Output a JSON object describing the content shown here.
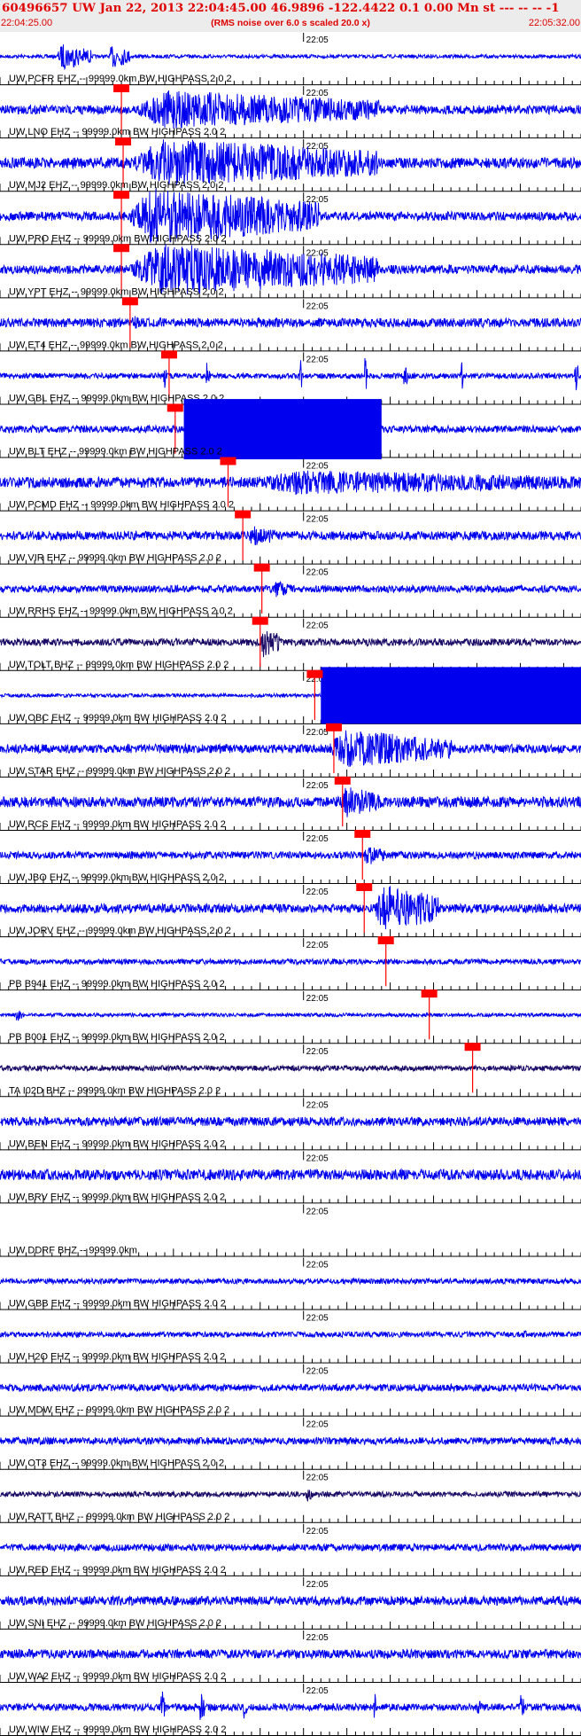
{
  "header": {
    "title": "60496657 UW Jan 22, 2013 22:04:45.00   46.9896 -122.4422  0.1 0.00 Mn st --- -- --  -1",
    "start_time": "22:04:25.00",
    "end_time": "22:05:32.00",
    "scale_note": "(RMS noise over 6.0 s scaled 20.0 x)"
  },
  "colors": {
    "trace": "#0000ee",
    "trace_dark": "#1a0a66",
    "pick": "#ff0000",
    "axis": "#000000",
    "header_bg": "#ececec",
    "title": "#e00000"
  },
  "chart_data": {
    "type": "line",
    "x_unit": "time (UTC)",
    "xlim": [
      "22:04:25.00",
      "22:05:32.00"
    ],
    "minute_tick_label": "22:05",
    "minute_tick_time": "22:05:00",
    "traces": [
      {
        "label": "UW PCFR EHZ -- 99999.0km BW  HIGHPASS  2.0  2",
        "pick_time": null,
        "noise": 2,
        "bursts": [
          [
            "22:04:31.5",
            "22:04:35.5",
            15
          ],
          [
            "22:04:37.5",
            "22:04:40.0",
            14
          ]
        ]
      },
      {
        "label": "UW LNO EHZ -- 99999.0km BW  HIGHPASS  2.0  2",
        "pick_time": "22:04:39.0",
        "noise": 5,
        "bursts": [
          [
            "22:04:39.5",
            "22:05:09.0",
            22
          ]
        ]
      },
      {
        "label": "UW MJ2 EHZ -- 99999.0km BW  HIGHPASS  2.0  2",
        "pick_time": "22:04:39.2",
        "noise": 6,
        "bursts": [
          [
            "22:04:39.4",
            "22:05:08.7",
            28
          ]
        ]
      },
      {
        "label": "UW PRO EHZ -- 99999.0km BW  HIGHPASS  2.0  2",
        "pick_time": "22:04:39.0",
        "noise": 5,
        "bursts": [
          [
            "22:04:39.2",
            "22:05:01.7",
            32
          ]
        ]
      },
      {
        "label": "UW YPT EHZ -- 99999.0km BW  HIGHPASS  2.0  2",
        "pick_time": "22:04:39.0",
        "noise": 5,
        "bursts": [
          [
            "22:04:39.2",
            "22:05:08.7",
            30
          ]
        ]
      },
      {
        "label": "UW ET4 EHZ -- 99999.0km BW  HIGHPASS  2.0  2",
        "pick_time": "22:04:40.0",
        "noise": 5,
        "bursts": [
          [
            "22:04:40.0",
            "22:04:42.0",
            8
          ]
        ]
      },
      {
        "label": "UW GBL EHZ -- 99999.0km BW  HIGHPASS  2.0  2",
        "pick_time": "22:04:44.5",
        "noise": 3,
        "bursts": [
          [
            "22:04:43.8",
            "22:04:44.2",
            20
          ],
          [
            "22:04:48.7",
            "22:04:49.2",
            18
          ],
          [
            "22:04:59.5",
            "22:04:59.8",
            22
          ],
          [
            "22:05:07.0",
            "22:05:07.3",
            24
          ],
          [
            "22:05:11.5",
            "22:05:12.0",
            22
          ],
          [
            "22:05:18.0",
            "22:05:18.4",
            24
          ],
          [
            "22:05:31.2",
            "22:05:31.6",
            22
          ]
        ]
      },
      {
        "label": "UW BLT EHZ -- 99999.0km BW  HIGHPASS  2.0  2",
        "pick_time": "22:04:45.2",
        "noise": 4,
        "blocks": [
          [
            "22:04:46.2",
            "22:05:09.0",
            34
          ]
        ]
      },
      {
        "label": "UW PCMD EHZ -- 99999.0km BW  HIGHPASS  2.0  2",
        "pick_time": "22:04:51.3",
        "noise": 6,
        "bursts": [
          [
            "22:04:53.0",
            "22:05:32.0",
            14
          ]
        ]
      },
      {
        "label": "UW VIR EHZ -- 99999.0km BW  HIGHPASS  2.0  2",
        "pick_time": "22:04:53.0",
        "noise": 5,
        "bursts": [
          [
            "22:04:53.5",
            "22:04:57.0",
            12
          ]
        ]
      },
      {
        "label": "UW RRHS EHZ -- 99999.0km BW  HIGHPASS  2.0  2",
        "pick_time": "22:04:55.2",
        "noise": 4,
        "bursts": [
          [
            "22:04:56.5",
            "22:04:58.5",
            10
          ]
        ]
      },
      {
        "label": "UW TOLT BHZ -- 99999.0km BW  HIGHPASS  2.0  2",
        "pick_time": "22:04:55.0",
        "noise": 4,
        "dark": true,
        "bursts": [
          [
            "22:04:55.0",
            "22:04:57.2",
            18
          ]
        ]
      },
      {
        "label": "UW OBC EHZ -- 99999.0km BW  HIGHPASS  2.0  2",
        "pick_time": "22:05:01.3",
        "noise": 2,
        "blocks": [
          [
            "22:05:02.0",
            "22:05:32.0",
            32
          ]
        ]
      },
      {
        "label": "UW STAR EHZ -- 99999.0km BW  HIGHPASS  2.0  2",
        "pick_time": "22:05:03.5",
        "noise": 5,
        "bursts": [
          [
            "22:05:02.5",
            "22:05:17.0",
            22
          ]
        ]
      },
      {
        "label": "UW RCS EHZ -- 99999.0km BW  HIGHPASS  2.0  2",
        "pick_time": "22:05:04.5",
        "noise": 6,
        "bursts": [
          [
            "22:05:04.0",
            "22:05:09.0",
            18
          ]
        ]
      },
      {
        "label": "UW JBO EHZ -- 99999.0km BW  HIGHPASS  2.0  2",
        "pick_time": "22:05:06.8",
        "noise": 4,
        "bursts": [
          [
            "22:05:06.8",
            "22:05:09.5",
            12
          ]
        ]
      },
      {
        "label": "UW JORV EHZ -- 99999.0km BW  HIGHPASS  2.0  2",
        "pick_time": "22:05:07.0",
        "noise": 5,
        "bursts": [
          [
            "22:05:08.0",
            "22:05:15.5",
            28
          ]
        ]
      },
      {
        "label": "PB B941 EHZ -- 99999.0km BW  HIGHPASS  2.0  2",
        "pick_time": "22:05:09.5",
        "noise": 3,
        "bursts": []
      },
      {
        "label": "PB B001 EHZ -- 99999.0km BW  HIGHPASS  2.0  2",
        "pick_time": "22:05:14.5",
        "noise": 2,
        "bursts": [
          [
            "22:04:26.7",
            "22:04:27.5",
            8
          ]
        ]
      },
      {
        "label": "TA I02D BHZ -- 99999.0km BW  HIGHPASS  2.0  2",
        "pick_time": "22:05:19.5",
        "noise": 3,
        "dark": true,
        "bursts": []
      },
      {
        "label": "UW BEN EHZ -- 99999.0km BW  HIGHPASS  2.0  2",
        "pick_time": null,
        "noise": 5,
        "bursts": []
      },
      {
        "label": "UW BRV EHZ -- 99999.0km BW  HIGHPASS  2.0  2",
        "pick_time": null,
        "noise": 6,
        "bursts": []
      },
      {
        "label": "UW DDRF BHZ -- 99999.0km",
        "pick_time": null,
        "flat": true,
        "bursts": []
      },
      {
        "label": "UW GBB EHZ -- 99999.0km BW  HIGHPASS  2.0  2",
        "pick_time": null,
        "noise": 3,
        "bursts": []
      },
      {
        "label": "UW H2O EHZ -- 99999.0km BW  HIGHPASS  2.0  2",
        "pick_time": null,
        "noise": 3,
        "bursts": [
          [
            "22:05:25.0",
            "22:05:26.0",
            6
          ]
        ]
      },
      {
        "label": "UW MDW EHZ -- 99999.0km BW  HIGHPASS  2.0  2",
        "pick_time": null,
        "noise": 4,
        "bursts": []
      },
      {
        "label": "UW OT3 EHZ -- 99999.0km BW  HIGHPASS  2.0  2",
        "pick_time": null,
        "noise": 4,
        "bursts": []
      },
      {
        "label": "UW RATT BHZ -- 99999.0km BW  HIGHPASS  2.0  2",
        "pick_time": null,
        "noise": 3,
        "dark": true,
        "bursts": [
          [
            "22:05:00.2",
            "22:05:01.2",
            8
          ]
        ]
      },
      {
        "label": "UW RED EHZ -- 99999.0km BW  HIGHPASS  2.0  2",
        "pick_time": null,
        "noise": 4,
        "bursts": []
      },
      {
        "label": "UW SNI EHZ -- 99999.0km BW  HIGHPASS  2.0  2",
        "pick_time": null,
        "noise": 5,
        "bursts": []
      },
      {
        "label": "UW WA2 EHZ -- 99999.0km BW  HIGHPASS  2.0  2",
        "pick_time": null,
        "noise": 5,
        "bursts": []
      },
      {
        "label": "UW WIW EHZ -- 99999.0km BW  HIGHPASS  2.0  2",
        "pick_time": null,
        "noise": 4,
        "bursts": [
          [
            "22:04:43.5",
            "22:04:44.0",
            22
          ],
          [
            "22:04:48.0",
            "22:04:48.5",
            20
          ],
          [
            "22:04:53.0",
            "22:04:53.4",
            16
          ],
          [
            "22:05:08.0",
            "22:05:08.5",
            18
          ],
          [
            "22:05:20.0",
            "22:05:20.5",
            16
          ],
          [
            "22:05:25.0",
            "22:05:25.4",
            18
          ]
        ]
      }
    ]
  }
}
